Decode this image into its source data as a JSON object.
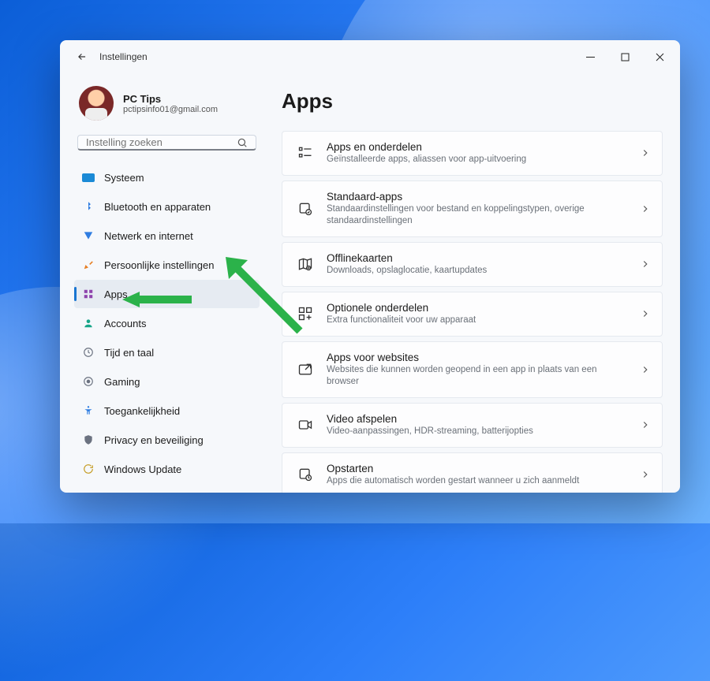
{
  "titlebar": {
    "title": "Instellingen"
  },
  "profile": {
    "name": "PC Tips",
    "email": "pctipsinfo01@gmail.com"
  },
  "search": {
    "placeholder": "Instelling zoeken"
  },
  "sidebar": {
    "items": [
      {
        "label": "Systeem"
      },
      {
        "label": "Bluetooth en apparaten"
      },
      {
        "label": "Netwerk en internet"
      },
      {
        "label": "Persoonlijke instellingen"
      },
      {
        "label": "Apps"
      },
      {
        "label": "Accounts"
      },
      {
        "label": "Tijd en taal"
      },
      {
        "label": "Gaming"
      },
      {
        "label": "Toegankelijkheid"
      },
      {
        "label": "Privacy en beveiliging"
      },
      {
        "label": "Windows Update"
      }
    ],
    "activeIndex": 4
  },
  "main": {
    "heading": "Apps",
    "cards": [
      {
        "title": "Apps en onderdelen",
        "sub": "Geïnstalleerde apps, aliassen voor app-uitvoering"
      },
      {
        "title": "Standaard-apps",
        "sub": "Standaardinstellingen voor bestand en koppelingstypen, overige standaardinstellingen"
      },
      {
        "title": "Offlinekaarten",
        "sub": "Downloads, opslaglocatie, kaartupdates"
      },
      {
        "title": "Optionele onderdelen",
        "sub": "Extra functionaliteit voor uw apparaat"
      },
      {
        "title": "Apps voor websites",
        "sub": "Websites die kunnen worden geopend in een app in plaats van een browser"
      },
      {
        "title": "Video afspelen",
        "sub": "Video-aanpassingen, HDR-streaming, batterijopties"
      },
      {
        "title": "Opstarten",
        "sub": "Apps die automatisch worden gestart wanneer u zich aanmeldt"
      }
    ]
  }
}
